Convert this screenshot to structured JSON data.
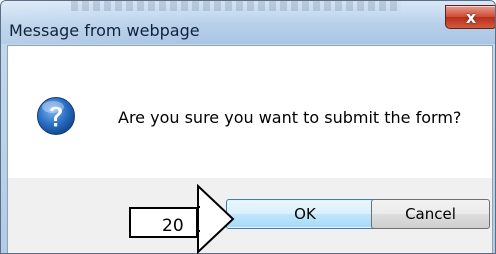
{
  "dialog": {
    "title": "Message from webpage",
    "close_glyph": "x",
    "icon": "question-icon",
    "message": "Are you sure you want to submit the form?",
    "ok_label": "OK",
    "cancel_label": "Cancel"
  },
  "annotation": {
    "step_number": "20"
  },
  "colors": {
    "title_bar": "#b7d0ea",
    "close_button": "#c7432b",
    "ok_highlight": "#3c7fb1",
    "icon_blue": "#1f63b8"
  }
}
